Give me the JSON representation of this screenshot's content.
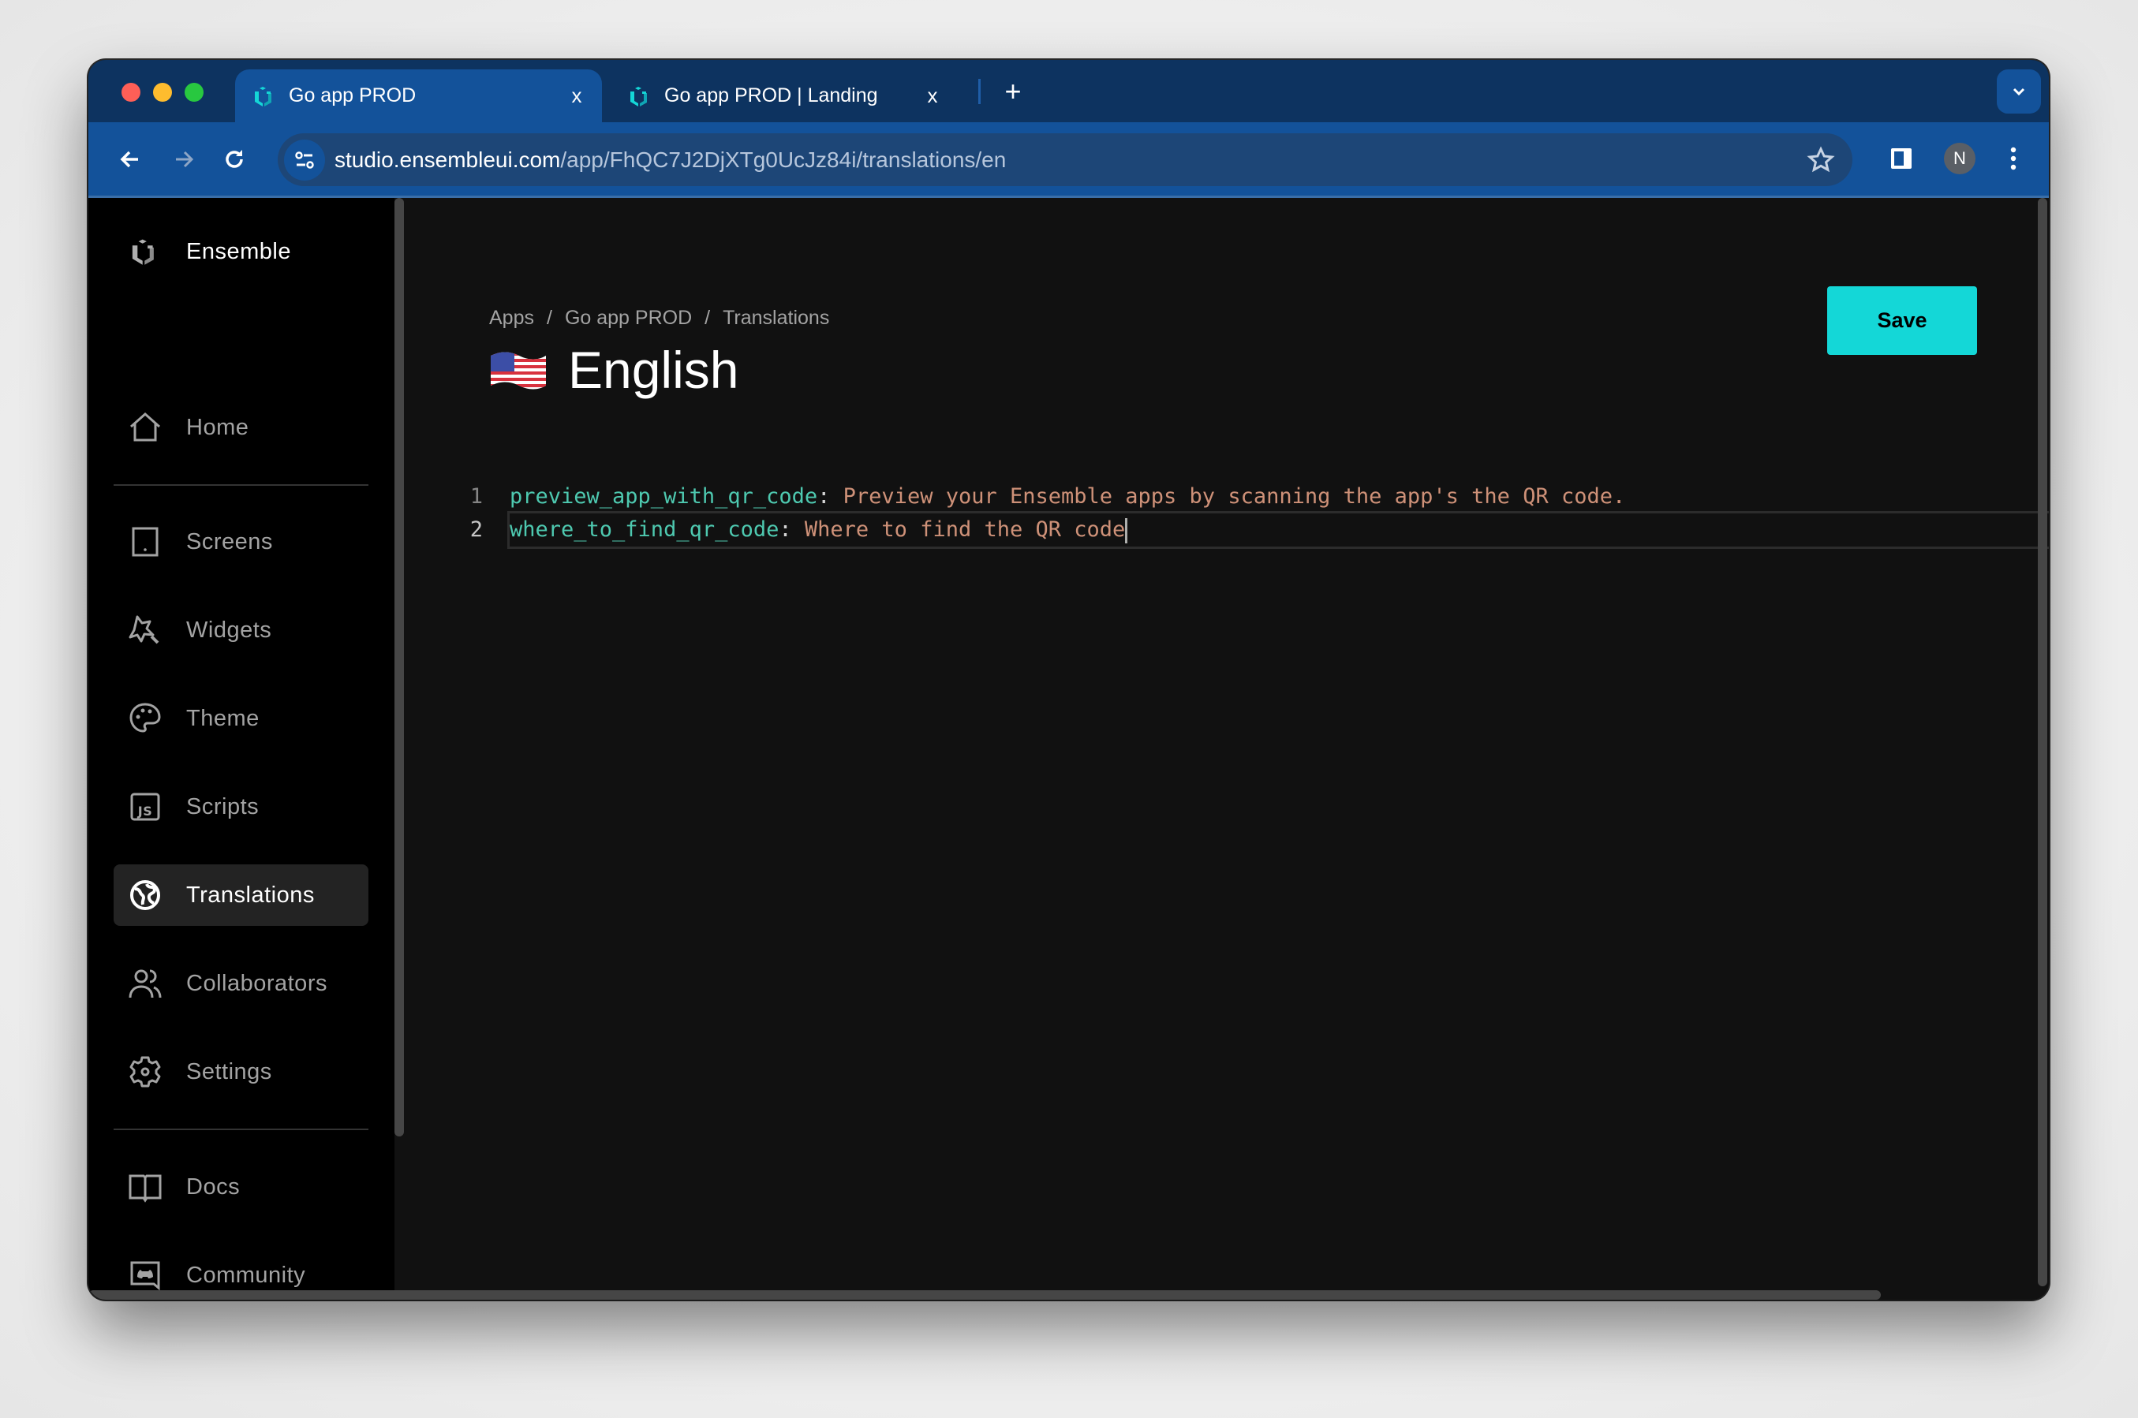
{
  "browser": {
    "tabs": [
      {
        "title": "Go app PROD",
        "active": true,
        "favicon": "ensemble-logo-icon"
      },
      {
        "title": "Go app PROD | Landing",
        "active": false,
        "favicon": "ensemble-logo-icon"
      }
    ],
    "close_glyph": "x",
    "new_tab_glyph": "+",
    "url_host": "studio.ensembleui.com",
    "url_path": "/app/FhQC7J2DjXTg0UcJz84i/translations/en",
    "profile_initial": "N"
  },
  "sidebar": {
    "brand": "Ensemble",
    "items": [
      {
        "label": "Home",
        "icon": "home-icon"
      },
      {
        "label": "Screens",
        "icon": "tablet-icon"
      },
      {
        "label": "Widgets",
        "icon": "magic-wand-icon"
      },
      {
        "label": "Theme",
        "icon": "palette-icon"
      },
      {
        "label": "Scripts",
        "icon": "js-icon"
      },
      {
        "label": "Translations",
        "icon": "globe-icon",
        "active": true
      },
      {
        "label": "Collaborators",
        "icon": "users-icon"
      },
      {
        "label": "Settings",
        "icon": "gear-icon"
      },
      {
        "label": "Docs",
        "icon": "book-icon"
      },
      {
        "label": "Community",
        "icon": "discord-icon"
      }
    ]
  },
  "main": {
    "breadcrumb": [
      "Apps",
      "Go app PROD",
      "Translations"
    ],
    "breadcrumb_separator": "/",
    "title": "English",
    "flag": "us-flag",
    "save_label": "Save",
    "editor": {
      "lines": [
        {
          "number": "1",
          "key": "preview_app_with_qr_code",
          "sep": ":",
          "value": " Preview your Ensemble apps by scanning the app's the QR code."
        },
        {
          "number": "2",
          "key": "where_to_find_qr_code",
          "sep": ":",
          "value": " Where to find the QR code"
        }
      ],
      "cursor_line": 2
    }
  },
  "colors": {
    "accent": "#14d7d7",
    "tabstrip": "#0d3360",
    "toolbar": "#13529a",
    "yaml_key": "#4ec9b0",
    "yaml_value": "#ce9178"
  }
}
